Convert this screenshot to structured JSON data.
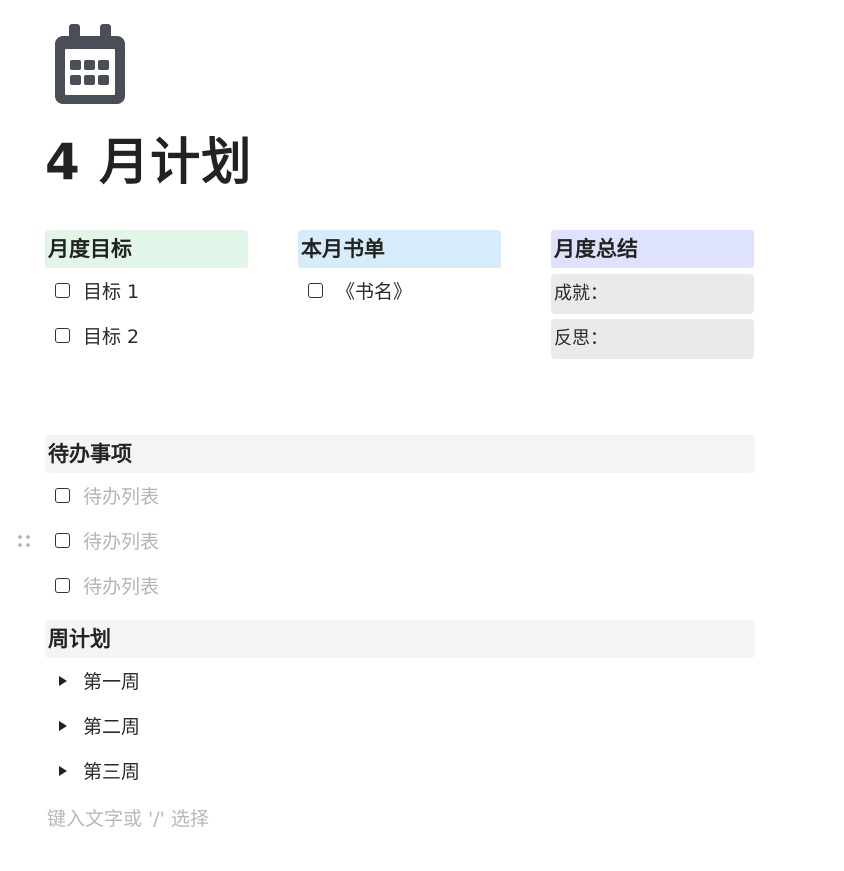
{
  "page": {
    "icon": "calendar-icon",
    "title": "4 月计划"
  },
  "columns": {
    "goals": {
      "heading": "月度目标",
      "heading_color": "#e2f5e9",
      "items": [
        {
          "label": "目标 1",
          "checked": false
        },
        {
          "label": "目标 2",
          "checked": false
        }
      ]
    },
    "books": {
      "heading": "本月书单",
      "heading_color": "#d6ecfa",
      "items": [
        {
          "label": "《书名》",
          "checked": false
        }
      ]
    },
    "summary": {
      "heading": "月度总结",
      "heading_color": "#dfe2fd",
      "achievements_label": "成就：",
      "reflection_label": "反思："
    }
  },
  "todo": {
    "heading": "待办事项",
    "items": [
      {
        "placeholder": "待办列表",
        "checked": false
      },
      {
        "placeholder": "待办列表",
        "checked": false
      },
      {
        "placeholder": "待办列表",
        "checked": false
      }
    ]
  },
  "weekly": {
    "heading": "周计划",
    "weeks": [
      "第一周",
      "第二周",
      "第三周"
    ]
  },
  "input_prompt": "键入文字或 '/' 选择",
  "colors": {
    "section_bg": "#f5f3f3",
    "summary_box_bg": "#ebe9e9",
    "icon_color": "#4a4f57"
  }
}
